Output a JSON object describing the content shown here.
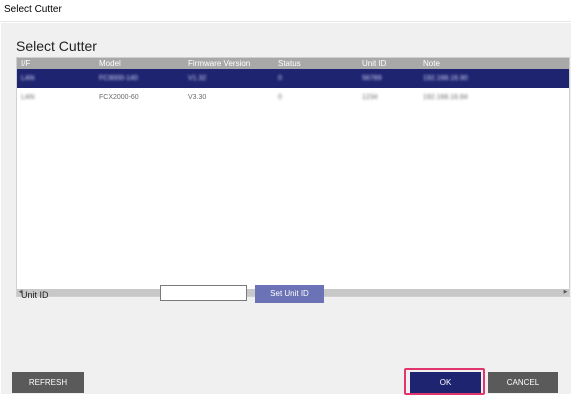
{
  "window": {
    "title": "Select Cutter"
  },
  "dialog": {
    "heading": "Select Cutter"
  },
  "table": {
    "columns": [
      "I/F",
      "Model",
      "Firmware Version",
      "Status",
      "Unit ID",
      "Note"
    ],
    "rows": [
      [
        "LAN",
        "FC9000-140",
        "V1.32",
        "0",
        "56789",
        "192.168.16.90"
      ],
      [
        "LAN",
        "FCX2000-60",
        "V3.30",
        "0",
        "1234",
        "192.168.16.84"
      ]
    ],
    "selected_row": 0
  },
  "unit_id": {
    "label": "Unit ID",
    "value": "",
    "set_button": "Set Unit ID"
  },
  "buttons": {
    "refresh": "REFRESH",
    "ok": "OK",
    "cancel": "CANCEL"
  },
  "colors": {
    "accent": "#1f2470",
    "highlight": "#e2356d"
  }
}
